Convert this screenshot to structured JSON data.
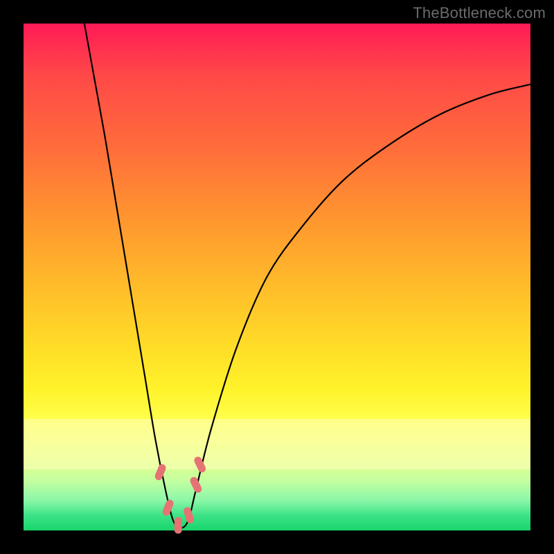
{
  "watermark": "TheBottleneck.com",
  "colors": {
    "frame": "#000000",
    "curve": "#000000",
    "marker_fill": "#e57373",
    "marker_stroke": "#c05050"
  },
  "chart_data": {
    "type": "line",
    "title": "",
    "xlabel": "",
    "ylabel": "",
    "xlim": [
      0,
      100
    ],
    "ylim": [
      0,
      100
    ],
    "note": "Axes are unlabeled in the source image; x is horizontal position (0–100%), y is bottleneck percentage (0 = good/green at bottom, 100 = bad/red at top). Values estimated from pixel positions.",
    "series": [
      {
        "name": "bottleneck-curve",
        "x": [
          12,
          14,
          16,
          18,
          20,
          22,
          24,
          26,
          28,
          29.5,
          31,
          32.5,
          34,
          37,
          42,
          48,
          55,
          63,
          72,
          82,
          92,
          100
        ],
        "y": [
          100,
          89,
          78,
          66,
          54,
          42,
          30,
          18,
          8,
          2,
          0.5,
          2,
          8,
          20,
          36,
          50,
          60,
          69,
          76,
          82,
          86,
          88
        ]
      }
    ],
    "markers": {
      "name": "highlight-segments",
      "note": "Short salmon/pink rounded markers overlaid near the curve minimum on both sides.",
      "points": [
        {
          "x": 27.0,
          "y": 11.5
        },
        {
          "x": 28.5,
          "y": 4.5
        },
        {
          "x": 30.5,
          "y": 1.0
        },
        {
          "x": 32.6,
          "y": 3.0
        },
        {
          "x": 34.0,
          "y": 9.0
        },
        {
          "x": 34.8,
          "y": 13.0
        }
      ]
    },
    "band": {
      "name": "acceptable-zone",
      "y_from": 12,
      "y_to": 22,
      "note": "Pale yellow horizontal band."
    }
  }
}
